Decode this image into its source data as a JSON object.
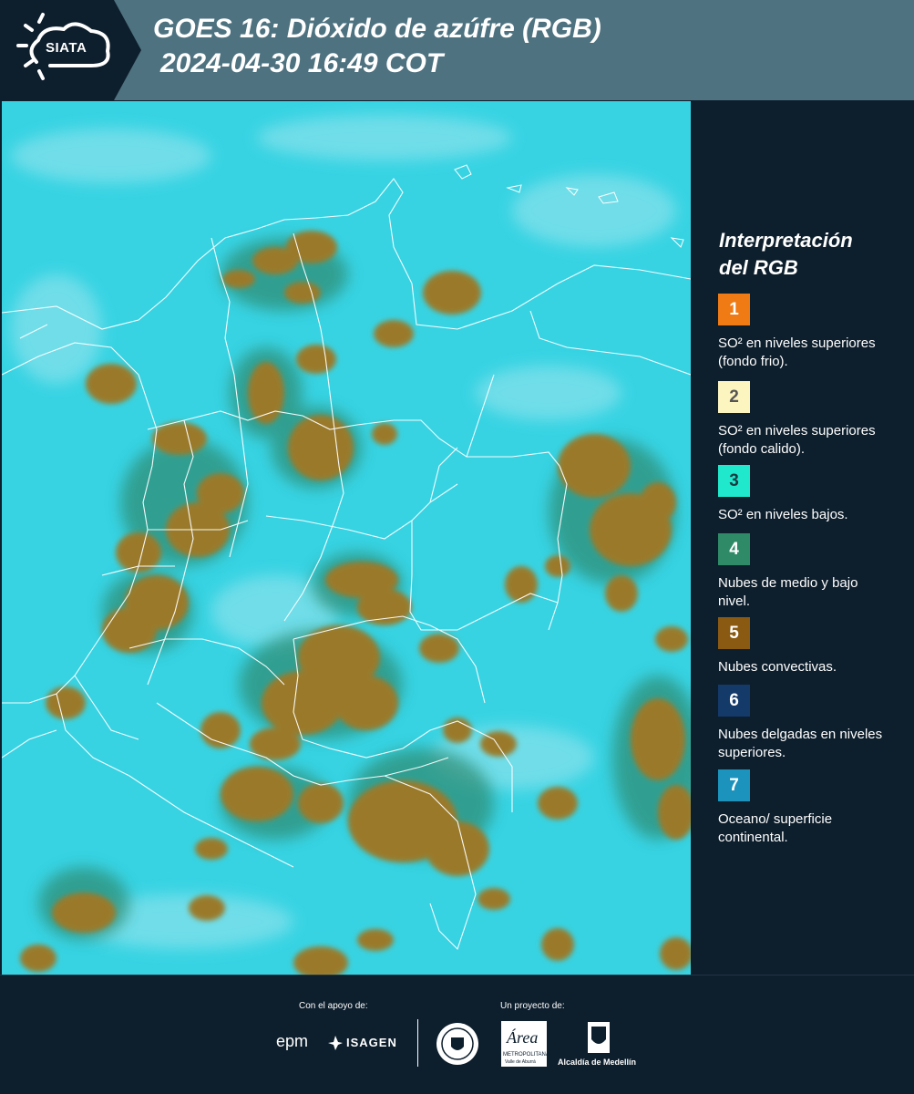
{
  "header": {
    "logo_text": "SIATA",
    "title": "GOES 16: Dióxido de azúfre (RGB)",
    "subtitle": "2024-04-30 16:49 COT"
  },
  "legend": {
    "title_line1": "Interpretación",
    "title_line2": "del RGB",
    "items": [
      {
        "num": "1",
        "color": "#f07a14",
        "text_color": "#ffffff",
        "label": "SO² en niveles superiores (fondo frio)."
      },
      {
        "num": "2",
        "color": "#fcf5c0",
        "text_color": "#555555",
        "label": "SO² en niveles superiores (fondo calido)."
      },
      {
        "num": "3",
        "color": "#1fe8cc",
        "text_color": "#1a3a40",
        "label": "SO² en niveles bajos."
      },
      {
        "num": "4",
        "color": "#2f8a68",
        "text_color": "#ffffff",
        "label": "Nubes de medio y bajo nivel."
      },
      {
        "num": "5",
        "color": "#8b5a12",
        "text_color": "#ffffff",
        "label": "Nubes convectivas."
      },
      {
        "num": "6",
        "color": "#143a6a",
        "text_color": "#ffffff",
        "label": "Nubes delgadas en niveles superiores."
      },
      {
        "num": "7",
        "color": "#1b93bd",
        "text_color": "#ffffff",
        "label": "Oceano/ superficie continental."
      }
    ]
  },
  "footer": {
    "support_label": "Con el apoyo de:",
    "project_label": "Un proyecto de:",
    "sponsor_epm": "epm",
    "sponsor_isagen": "ISAGEN",
    "sponsor_area": "Área",
    "sponsor_area_sub": "METROPOLITANA",
    "sponsor_area_sub2": "Valle de Aburrá",
    "sponsor_alcaldia": "Alcaldía de Medellín"
  }
}
